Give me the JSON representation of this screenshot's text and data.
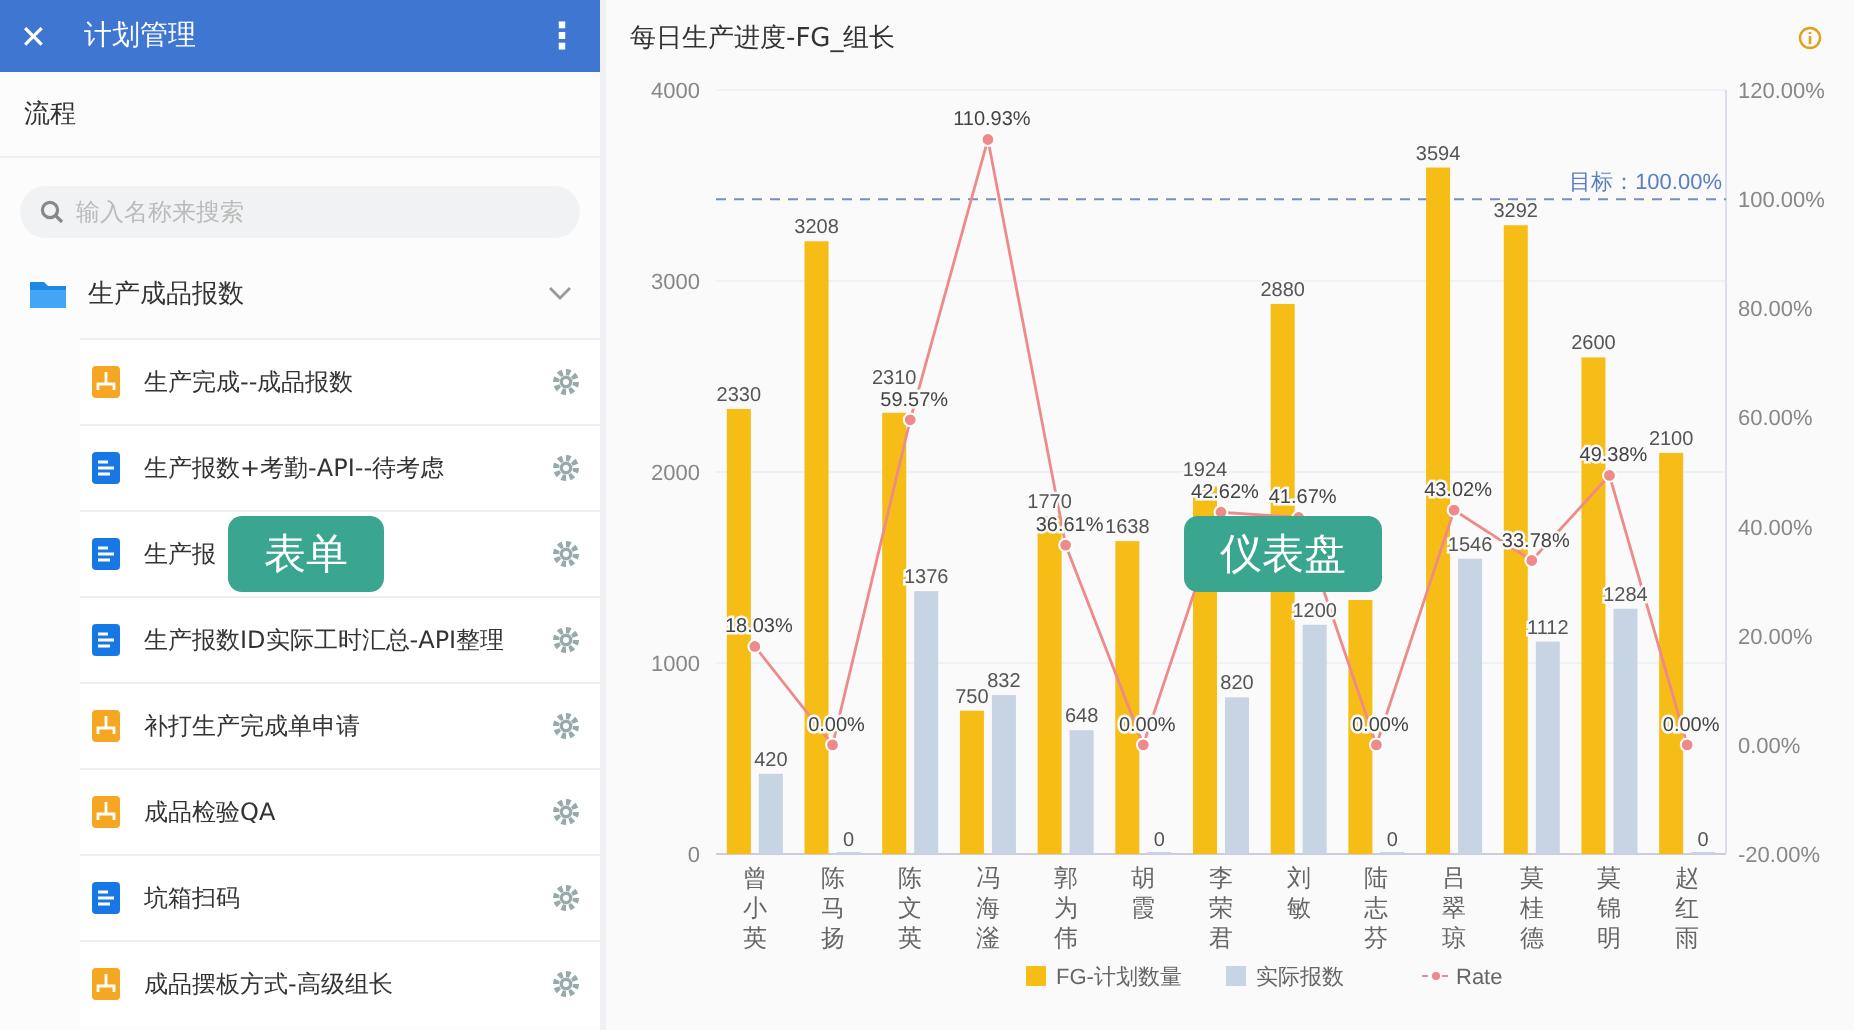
{
  "header": {
    "close": "✕",
    "title": "计划管理",
    "more": "⋮"
  },
  "tab_label": "流程",
  "search": {
    "placeholder": "输入名称来搜索"
  },
  "group": {
    "label": "生产成品报数",
    "expanded": true,
    "items": [
      {
        "label": "生产完成--成品报数",
        "kind": "flow"
      },
      {
        "label": "生产报数+考勤-API--待考虑",
        "kind": "form"
      },
      {
        "label": "生产报",
        "kind": "form"
      },
      {
        "label": "生产报数ID实际工时汇总-API整理",
        "kind": "form"
      },
      {
        "label": "补打生产完成单申请",
        "kind": "flow"
      },
      {
        "label": "成品检验QA",
        "kind": "flow"
      },
      {
        "label": "坑箱扫码",
        "kind": "form"
      },
      {
        "label": "成品摆板方式-高级组长",
        "kind": "flow"
      }
    ]
  },
  "callouts": [
    {
      "label": "表单",
      "kind": "form"
    },
    {
      "label": "仪表盘",
      "kind": "dashboard"
    }
  ],
  "chart": {
    "title": "每日生产进度-FG_组长",
    "chart_data": {
      "type": "bar",
      "stacked": false,
      "categories": [
        "曾小英",
        "陈马扬",
        "陈文英",
        "冯海滏",
        "郭为伟",
        "胡霞",
        "李荣君",
        "刘敏",
        "陆志芬",
        "吕翠琼",
        "莫桂德",
        "莫锦明",
        "赵红雨"
      ],
      "series": [
        {
          "name": "FG-计划数量",
          "color": "#f6bd16",
          "values": [
            2330,
            3208,
            2310,
            750,
            1770,
            1638,
            1924,
            2880,
            1330,
            3594,
            3292,
            2600,
            2100
          ],
          "value_labels": [
            "2330",
            "3208",
            "2310",
            "750",
            "1770",
            "1638",
            "1924",
            "2880",
            null,
            "3594",
            "3292",
            "2600",
            "2100"
          ]
        },
        {
          "name": "实际报数",
          "color": "#c6d4e4",
          "values": [
            420,
            0,
            1376,
            832,
            648,
            0,
            820,
            1200,
            0,
            1546,
            1112,
            1284,
            0
          ],
          "value_labels": [
            "420",
            "0",
            "1376",
            "832",
            "648",
            "0",
            "820",
            "1200",
            "0",
            "1546",
            "1112",
            "1284",
            "0"
          ]
        },
        {
          "name": "Rate",
          "type": "line",
          "axis": "y2",
          "marker": "circle",
          "color": "#ee8a8a",
          "values": [
            18.03,
            0,
            59.57,
            110.93,
            36.61,
            0,
            42.62,
            41.67,
            0,
            43.02,
            33.78,
            49.38,
            0
          ],
          "value_labels": [
            "18.03%",
            "0.00%",
            "59.57%",
            "110.93%",
            "36.61%",
            "0.00%",
            "42.62%",
            "41.67%",
            "0.00%",
            "43.02%",
            "33.78%",
            "49.38%",
            "0.00%"
          ]
        }
      ],
      "ylim": [
        0,
        4000
      ],
      "yticks": [
        0,
        1000,
        2000,
        3000,
        4000
      ],
      "y2lim": [
        -20,
        120
      ],
      "y2ticks": [
        {
          "value": -20,
          "label": "-20.00%"
        },
        {
          "value": 0,
          "label": "0.00%"
        },
        {
          "value": 20,
          "label": "20.00%"
        },
        {
          "value": 40,
          "label": "40.00%"
        },
        {
          "value": 60,
          "label": "60.00%"
        },
        {
          "value": 80,
          "label": "80.00%"
        },
        {
          "value": 100,
          "label": "100.00%"
        },
        {
          "value": 120,
          "label": "120.00%"
        }
      ],
      "data_labels": true,
      "grid": true,
      "legend": true,
      "ref_lines": [
        {
          "axis": "y2",
          "value": 100,
          "label": "目标：100.00%"
        }
      ]
    }
  }
}
